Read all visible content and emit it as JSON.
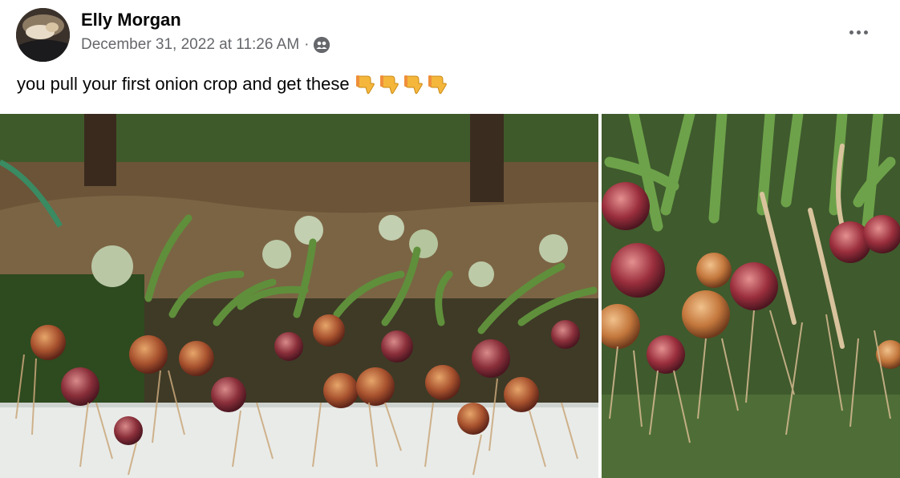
{
  "post": {
    "author": "Elly Morgan",
    "timestamp": "December 31, 2022 at 11:26 AM",
    "separator": "·",
    "audience_icon": "friends-icon",
    "more_icon": "more-horizontal-icon",
    "caption": "you pull your first onion crop and get these",
    "caption_emoji_icon": "backhand-index-pointing-down-icon",
    "caption_emoji_count": 4
  },
  "photos": [
    {
      "name": "onion-harvest-photo-wide",
      "description_icon": "photo"
    },
    {
      "name": "onion-harvest-photo-closeup",
      "description_icon": "photo"
    }
  ],
  "colors": {
    "author_text": "#050505",
    "meta_text": "#65676b",
    "background": "#ffffff",
    "emoji_yellow": "#f5b73b"
  }
}
